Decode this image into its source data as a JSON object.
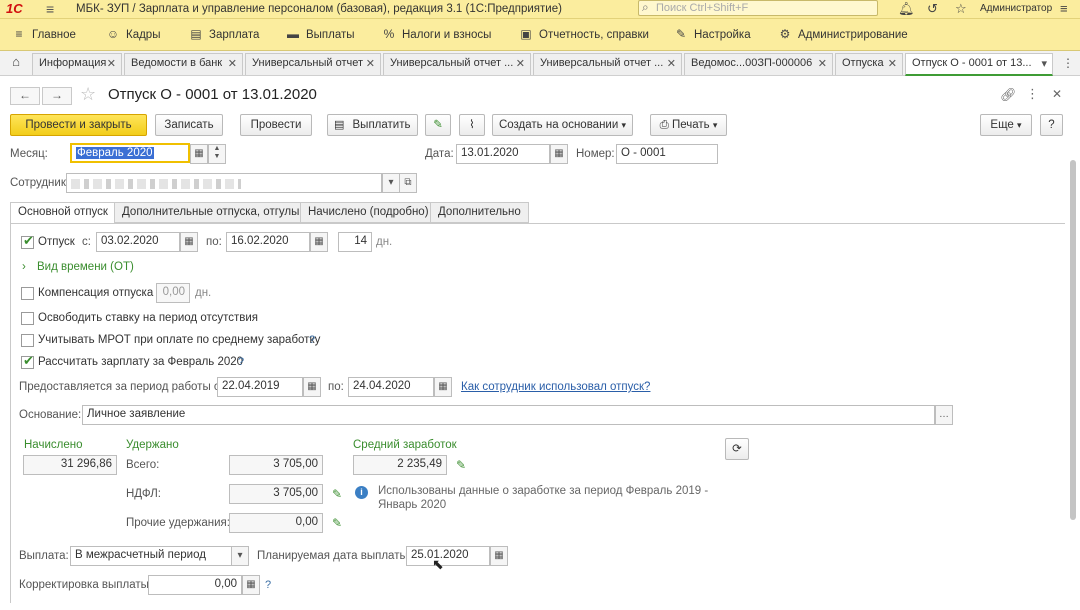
{
  "app": {
    "logo": "1С",
    "title": "МБК- ЗУП / Зарплата и управление персоналом (базовая), редакция 3.1  (1С:Предприятие)",
    "search_placeholder": "Поиск Ctrl+Shift+F",
    "user": "Администратор"
  },
  "main_menu": [
    {
      "icon": "≡",
      "label": "Главное"
    },
    {
      "icon": "☺",
      "label": "Кадры"
    },
    {
      "icon": "▤",
      "label": "Зарплата"
    },
    {
      "icon": "▬",
      "label": "Выплаты"
    },
    {
      "icon": "%",
      "label": "Налоги и взносы"
    },
    {
      "icon": "▣",
      "label": "Отчетность, справки"
    },
    {
      "icon": "✎",
      "label": "Настройка"
    },
    {
      "icon": "⚙",
      "label": "Администрирование"
    }
  ],
  "window_tabs": [
    {
      "label": "Информация"
    },
    {
      "label": "Ведомости в банк"
    },
    {
      "label": "Универсальный отчет"
    },
    {
      "label": "Универсальный отчет ..."
    },
    {
      "label": "Универсальный отчет ..."
    },
    {
      "label": "Ведомос...00ЗП-000006"
    },
    {
      "label": "Отпуска"
    },
    {
      "label": "Отпуск О - 0001 от 13..."
    }
  ],
  "document": {
    "title": "Отпуск О - 0001 от 13.01.2020"
  },
  "toolbar": {
    "post_close": "Провести и закрыть",
    "save": "Записать",
    "post": "Провести",
    "pay": "Выплатить",
    "create_based": "Создать на основании",
    "print": "Печать",
    "more": "Еще",
    "help": "?"
  },
  "header": {
    "month_label": "Месяц:",
    "month_value": "Февраль 2020",
    "date_label": "Дата:",
    "date_value": "13.01.2020",
    "number_label": "Номер:",
    "number_value": "О - 0001",
    "employee_label": "Сотрудник:"
  },
  "form_tabs": [
    {
      "label": "Основной отпуск"
    },
    {
      "label": "Дополнительные отпуска, отгулы"
    },
    {
      "label": "Начислено (подробно)"
    },
    {
      "label": "Дополнительно"
    }
  ],
  "main": {
    "vacation_label": "Отпуск",
    "from_label": "с:",
    "from_value": "03.02.2020",
    "to_label": "по:",
    "to_value": "16.02.2020",
    "days_value": "14",
    "days_unit": "дн.",
    "time_type": "Вид времени (ОТ)",
    "compensation_label": "Компенсация отпуска",
    "compensation_value": "0,00",
    "compensation_unit": "дн.",
    "free_rate_label": "Освободить ставку на период отсутствия",
    "mrot_label": "Учитывать МРОТ при оплате по среднему заработку",
    "calc_salary_label": "Рассчитать зарплату за Февраль 2020",
    "period_label": "Предоставляется за период работы с:",
    "period_from": "22.04.2019",
    "period_to_label": "по:",
    "period_to": "24.04.2020",
    "usage_link": "Как сотрудник использовал отпуск?",
    "basis_label": "Основание:",
    "basis_value": "Личное заявление",
    "accrued_header": "Начислено",
    "accrued_value": "31 296,86",
    "withheld_header": "Удержано",
    "total_label": "Всего:",
    "total_value": "3 705,00",
    "ndfl_label": "НДФЛ:",
    "ndfl_value": "3 705,00",
    "other_label": "Прочие удержания:",
    "other_value": "0,00",
    "avg_header": "Средний заработок",
    "avg_value": "2 235,49",
    "info_text_1": "Использованы данные о заработке за период Февраль 2019 -",
    "info_text_2": "Январь 2020",
    "payout_label": "Выплата:",
    "payout_value": "В межрасчетный период",
    "planned_date_label": "Планируемая дата выплаты:",
    "planned_date_value": "25.01.2020",
    "correction_label": "Корректировка выплаты:",
    "correction_value": "0,00"
  },
  "colors": {
    "header_bg": "#fbed9e",
    "primary_button": "#f2cd1a",
    "accent_green": "#3a8d2e",
    "link_blue": "#2a5ea8"
  }
}
